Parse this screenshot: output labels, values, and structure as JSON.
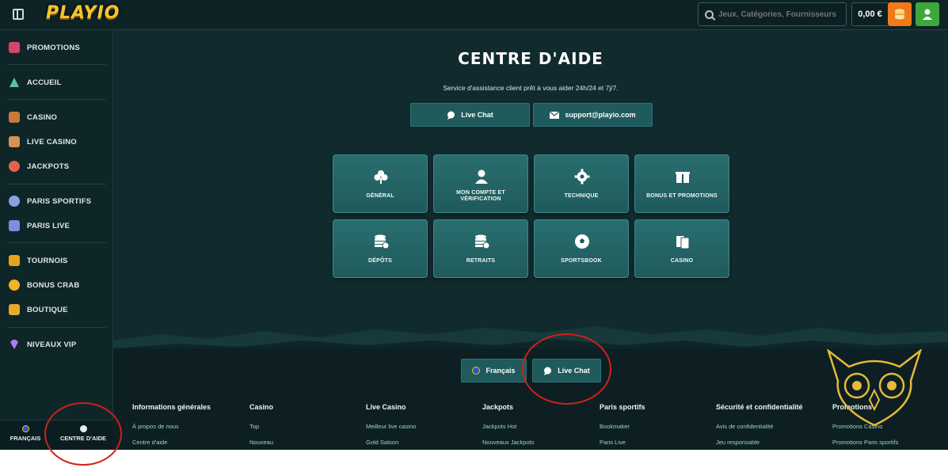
{
  "header": {
    "logo": "PLAYIO",
    "search_placeholder": "Jeux, Catégories, Fournisseurs",
    "balance": "0,00 €"
  },
  "sidebar": {
    "items": [
      {
        "label": "PROMOTIONS",
        "icon": "gift-icon"
      },
      {
        "label": "ACCUEIL",
        "icon": "home-icon"
      },
      {
        "label": "CASINO",
        "icon": "treasure-chest-icon"
      },
      {
        "label": "LIVE CASINO",
        "icon": "cards-icon"
      },
      {
        "label": "JACKPOTS",
        "icon": "clover-icon"
      },
      {
        "label": "PARIS SPORTIFS",
        "icon": "soccer-ball-icon"
      },
      {
        "label": "PARIS LIVE",
        "icon": "live-robot-icon"
      },
      {
        "label": "TOURNOIS",
        "icon": "trophy-icon"
      },
      {
        "label": "BONUS CRAB",
        "icon": "crab-icon"
      },
      {
        "label": "BOUTIQUE",
        "icon": "shopping-bag-icon"
      },
      {
        "label": "NIVEAUX VIP",
        "icon": "diamond-icon"
      }
    ],
    "bottom": {
      "language": "FRANÇAIS",
      "help": "CENTRE D'AIDE"
    }
  },
  "hero": {
    "title": "CENTRE D'AIDE",
    "subtitle": "Service d'assistance client prêt à vous aider 24h/24 et 7j/7.",
    "live_chat": "Live Chat",
    "email": "support@playio.com"
  },
  "categories": [
    {
      "label": "GÉNÉRAL",
      "icon": "clover-icon"
    },
    {
      "label": "MON COMPTE ET VÉRIFICATION",
      "icon": "user-icon"
    },
    {
      "label": "TECHNIQUE",
      "icon": "gear-icon"
    },
    {
      "label": "BONUS ET PROMOTIONS",
      "icon": "gift-icon"
    },
    {
      "label": "DÉPÔTS",
      "icon": "coins-plus-icon"
    },
    {
      "label": "RETRAITS",
      "icon": "coins-minus-icon"
    },
    {
      "label": "SPORTSBOOK",
      "icon": "soccer-ball-icon"
    },
    {
      "label": "CASINO",
      "icon": "cards-icon"
    }
  ],
  "footer": {
    "language_button": "Français",
    "live_chat_button": "Live Chat",
    "columns": [
      {
        "title": "Informations générales",
        "links": [
          "À propos de nous",
          "Centre d'aide"
        ]
      },
      {
        "title": "Casino",
        "links": [
          "Top",
          "Nouveau"
        ]
      },
      {
        "title": "Live Casino",
        "links": [
          "Meilleur live casino",
          "Gold Saloon"
        ]
      },
      {
        "title": "Jackpots",
        "links": [
          "Jackpots Hot",
          "Nouveaux Jackpots"
        ]
      },
      {
        "title": "Paris sportifs",
        "links": [
          "Bookmaker",
          "Paris Live"
        ]
      },
      {
        "title": "Sécurité et confidentialité",
        "links": [
          "Avis de confidentialité",
          "Jeu responsable"
        ]
      },
      {
        "title": "Promotions",
        "links": [
          "Promotions Casino",
          "Promotions Paris sportifs"
        ]
      }
    ]
  },
  "colors": {
    "background": "#112a2d",
    "card": "#1f5a5c",
    "link": "#9cd5cf",
    "deposit": "#f07a1a",
    "profile": "#3ea63a",
    "logo": "#f4c531",
    "annotation": "#d0201a"
  }
}
